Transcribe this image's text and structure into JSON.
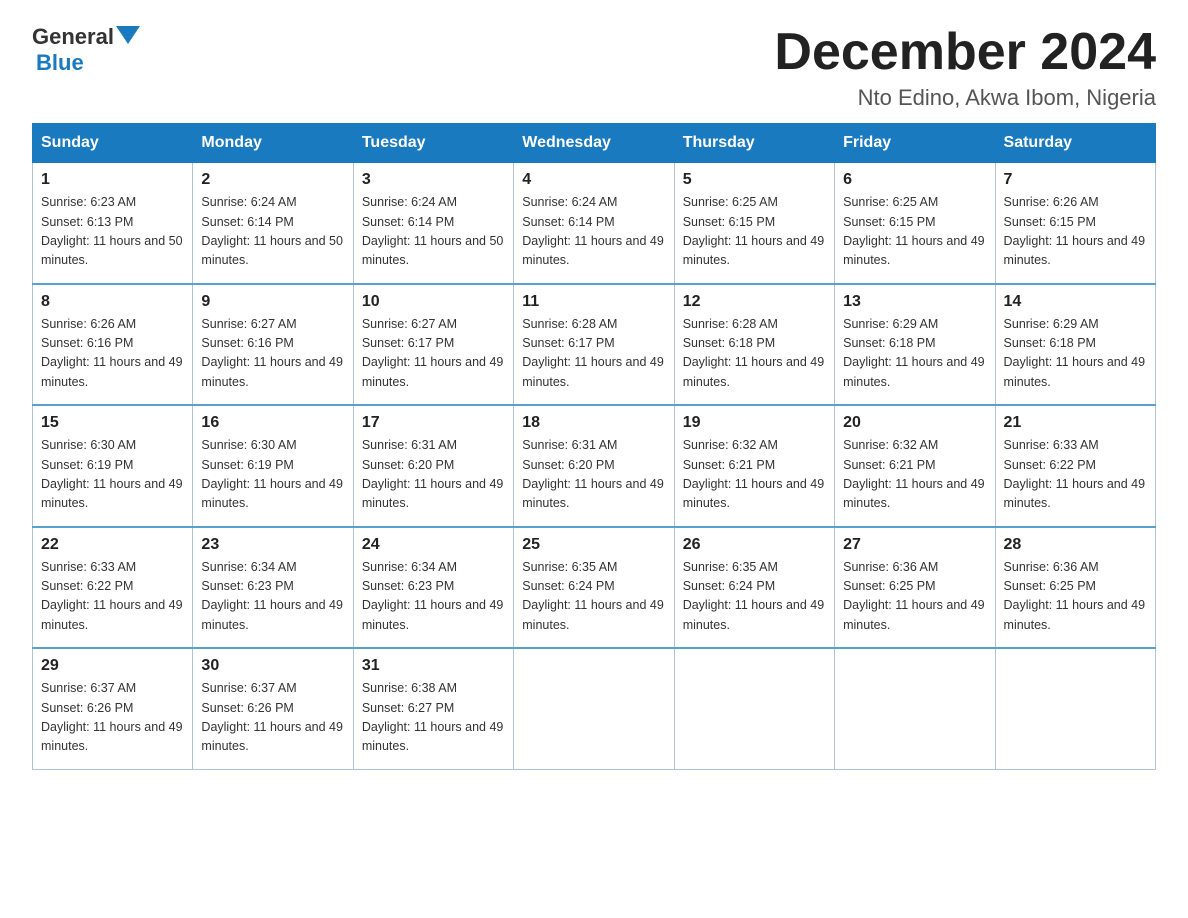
{
  "logo": {
    "general": "General",
    "blue": "Blue"
  },
  "title": "December 2024",
  "subtitle": "Nto Edino, Akwa Ibom, Nigeria",
  "weekdays": [
    "Sunday",
    "Monday",
    "Tuesday",
    "Wednesday",
    "Thursday",
    "Friday",
    "Saturday"
  ],
  "weeks": [
    [
      {
        "day": "1",
        "sunrise": "6:23 AM",
        "sunset": "6:13 PM",
        "daylight": "11 hours and 50 minutes."
      },
      {
        "day": "2",
        "sunrise": "6:24 AM",
        "sunset": "6:14 PM",
        "daylight": "11 hours and 50 minutes."
      },
      {
        "day": "3",
        "sunrise": "6:24 AM",
        "sunset": "6:14 PM",
        "daylight": "11 hours and 50 minutes."
      },
      {
        "day": "4",
        "sunrise": "6:24 AM",
        "sunset": "6:14 PM",
        "daylight": "11 hours and 49 minutes."
      },
      {
        "day": "5",
        "sunrise": "6:25 AM",
        "sunset": "6:15 PM",
        "daylight": "11 hours and 49 minutes."
      },
      {
        "day": "6",
        "sunrise": "6:25 AM",
        "sunset": "6:15 PM",
        "daylight": "11 hours and 49 minutes."
      },
      {
        "day": "7",
        "sunrise": "6:26 AM",
        "sunset": "6:15 PM",
        "daylight": "11 hours and 49 minutes."
      }
    ],
    [
      {
        "day": "8",
        "sunrise": "6:26 AM",
        "sunset": "6:16 PM",
        "daylight": "11 hours and 49 minutes."
      },
      {
        "day": "9",
        "sunrise": "6:27 AM",
        "sunset": "6:16 PM",
        "daylight": "11 hours and 49 minutes."
      },
      {
        "day": "10",
        "sunrise": "6:27 AM",
        "sunset": "6:17 PM",
        "daylight": "11 hours and 49 minutes."
      },
      {
        "day": "11",
        "sunrise": "6:28 AM",
        "sunset": "6:17 PM",
        "daylight": "11 hours and 49 minutes."
      },
      {
        "day": "12",
        "sunrise": "6:28 AM",
        "sunset": "6:18 PM",
        "daylight": "11 hours and 49 minutes."
      },
      {
        "day": "13",
        "sunrise": "6:29 AM",
        "sunset": "6:18 PM",
        "daylight": "11 hours and 49 minutes."
      },
      {
        "day": "14",
        "sunrise": "6:29 AM",
        "sunset": "6:18 PM",
        "daylight": "11 hours and 49 minutes."
      }
    ],
    [
      {
        "day": "15",
        "sunrise": "6:30 AM",
        "sunset": "6:19 PM",
        "daylight": "11 hours and 49 minutes."
      },
      {
        "day": "16",
        "sunrise": "6:30 AM",
        "sunset": "6:19 PM",
        "daylight": "11 hours and 49 minutes."
      },
      {
        "day": "17",
        "sunrise": "6:31 AM",
        "sunset": "6:20 PM",
        "daylight": "11 hours and 49 minutes."
      },
      {
        "day": "18",
        "sunrise": "6:31 AM",
        "sunset": "6:20 PM",
        "daylight": "11 hours and 49 minutes."
      },
      {
        "day": "19",
        "sunrise": "6:32 AM",
        "sunset": "6:21 PM",
        "daylight": "11 hours and 49 minutes."
      },
      {
        "day": "20",
        "sunrise": "6:32 AM",
        "sunset": "6:21 PM",
        "daylight": "11 hours and 49 minutes."
      },
      {
        "day": "21",
        "sunrise": "6:33 AM",
        "sunset": "6:22 PM",
        "daylight": "11 hours and 49 minutes."
      }
    ],
    [
      {
        "day": "22",
        "sunrise": "6:33 AM",
        "sunset": "6:22 PM",
        "daylight": "11 hours and 49 minutes."
      },
      {
        "day": "23",
        "sunrise": "6:34 AM",
        "sunset": "6:23 PM",
        "daylight": "11 hours and 49 minutes."
      },
      {
        "day": "24",
        "sunrise": "6:34 AM",
        "sunset": "6:23 PM",
        "daylight": "11 hours and 49 minutes."
      },
      {
        "day": "25",
        "sunrise": "6:35 AM",
        "sunset": "6:24 PM",
        "daylight": "11 hours and 49 minutes."
      },
      {
        "day": "26",
        "sunrise": "6:35 AM",
        "sunset": "6:24 PM",
        "daylight": "11 hours and 49 minutes."
      },
      {
        "day": "27",
        "sunrise": "6:36 AM",
        "sunset": "6:25 PM",
        "daylight": "11 hours and 49 minutes."
      },
      {
        "day": "28",
        "sunrise": "6:36 AM",
        "sunset": "6:25 PM",
        "daylight": "11 hours and 49 minutes."
      }
    ],
    [
      {
        "day": "29",
        "sunrise": "6:37 AM",
        "sunset": "6:26 PM",
        "daylight": "11 hours and 49 minutes."
      },
      {
        "day": "30",
        "sunrise": "6:37 AM",
        "sunset": "6:26 PM",
        "daylight": "11 hours and 49 minutes."
      },
      {
        "day": "31",
        "sunrise": "6:38 AM",
        "sunset": "6:27 PM",
        "daylight": "11 hours and 49 minutes."
      },
      null,
      null,
      null,
      null
    ]
  ]
}
